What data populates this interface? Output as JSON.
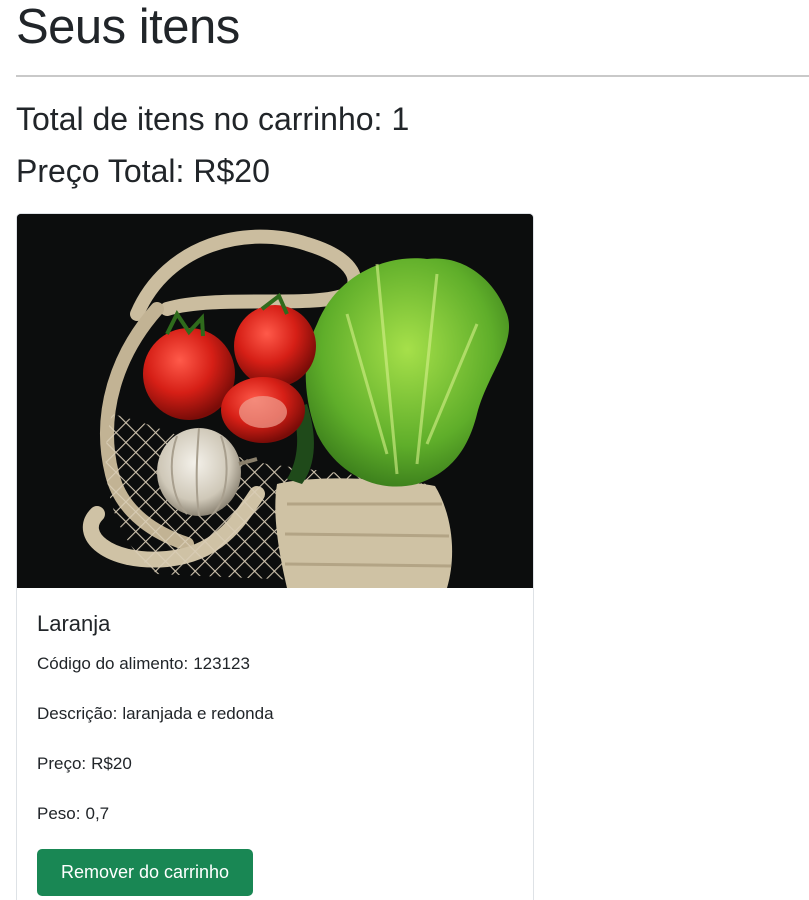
{
  "header": {
    "title": "Seus itens"
  },
  "summary": {
    "total_items_label": "Total de itens no carrinho:",
    "total_items_value": "1",
    "total_price_label": "Preço Total:",
    "total_price_value": "R$20"
  },
  "cart": {
    "items": [
      {
        "image_icon": "groceries-photo",
        "name": "Laranja",
        "code_label": "Código do alimento:",
        "code_value": "123123",
        "description_label": "Descrição:",
        "description_value": "laranjada e redonda",
        "price_label": "Preço:",
        "price_value": "R$20",
        "weight_label": "Peso:",
        "weight_value": "0,7",
        "remove_button_label": "Remover do carrinho"
      }
    ]
  },
  "colors": {
    "button_primary": "#198754",
    "divider": "#c9c9c9",
    "text": "#212529"
  }
}
